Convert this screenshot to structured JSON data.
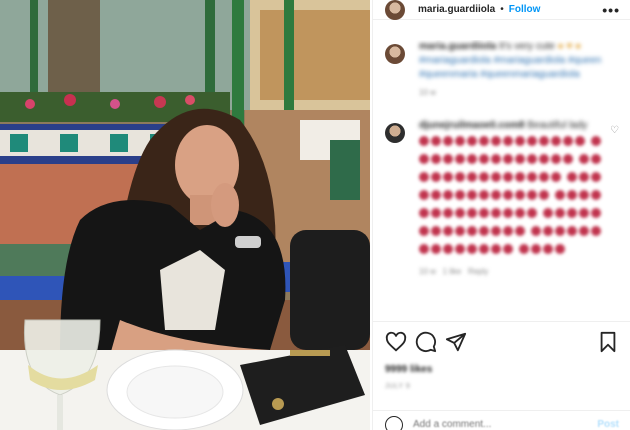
{
  "header": {
    "username": "maria.guardiiola",
    "separator": "•",
    "follow_label": "Follow",
    "more_label": "•••"
  },
  "caption": {
    "username": "maria.guardiiola",
    "text": "It's very cute",
    "hashtags": "#mariaguardiola #mariaguardiola #queen #queenmaria #queenmariaguardiola",
    "time": "10 w"
  },
  "comment": {
    "username": "djunejruilmaoe0.com8",
    "text": "Beautiful lady",
    "time": "10 w",
    "likes": "1 like",
    "reply": "Reply"
  },
  "stats": {
    "likes": "9999 likes",
    "date": "JULY 9"
  },
  "add_comment": {
    "placeholder": "Add a comment...",
    "post_label": "Post"
  },
  "icons": {
    "more": "more-icon",
    "like": "heart-icon",
    "comment": "comment-icon",
    "share": "share-icon",
    "save": "bookmark-icon",
    "emoji": "smile-icon"
  },
  "colors": {
    "accent": "#0095f6",
    "text": "#262626",
    "muted": "#8e8e8e",
    "emoji_heart": "#c0334d"
  }
}
